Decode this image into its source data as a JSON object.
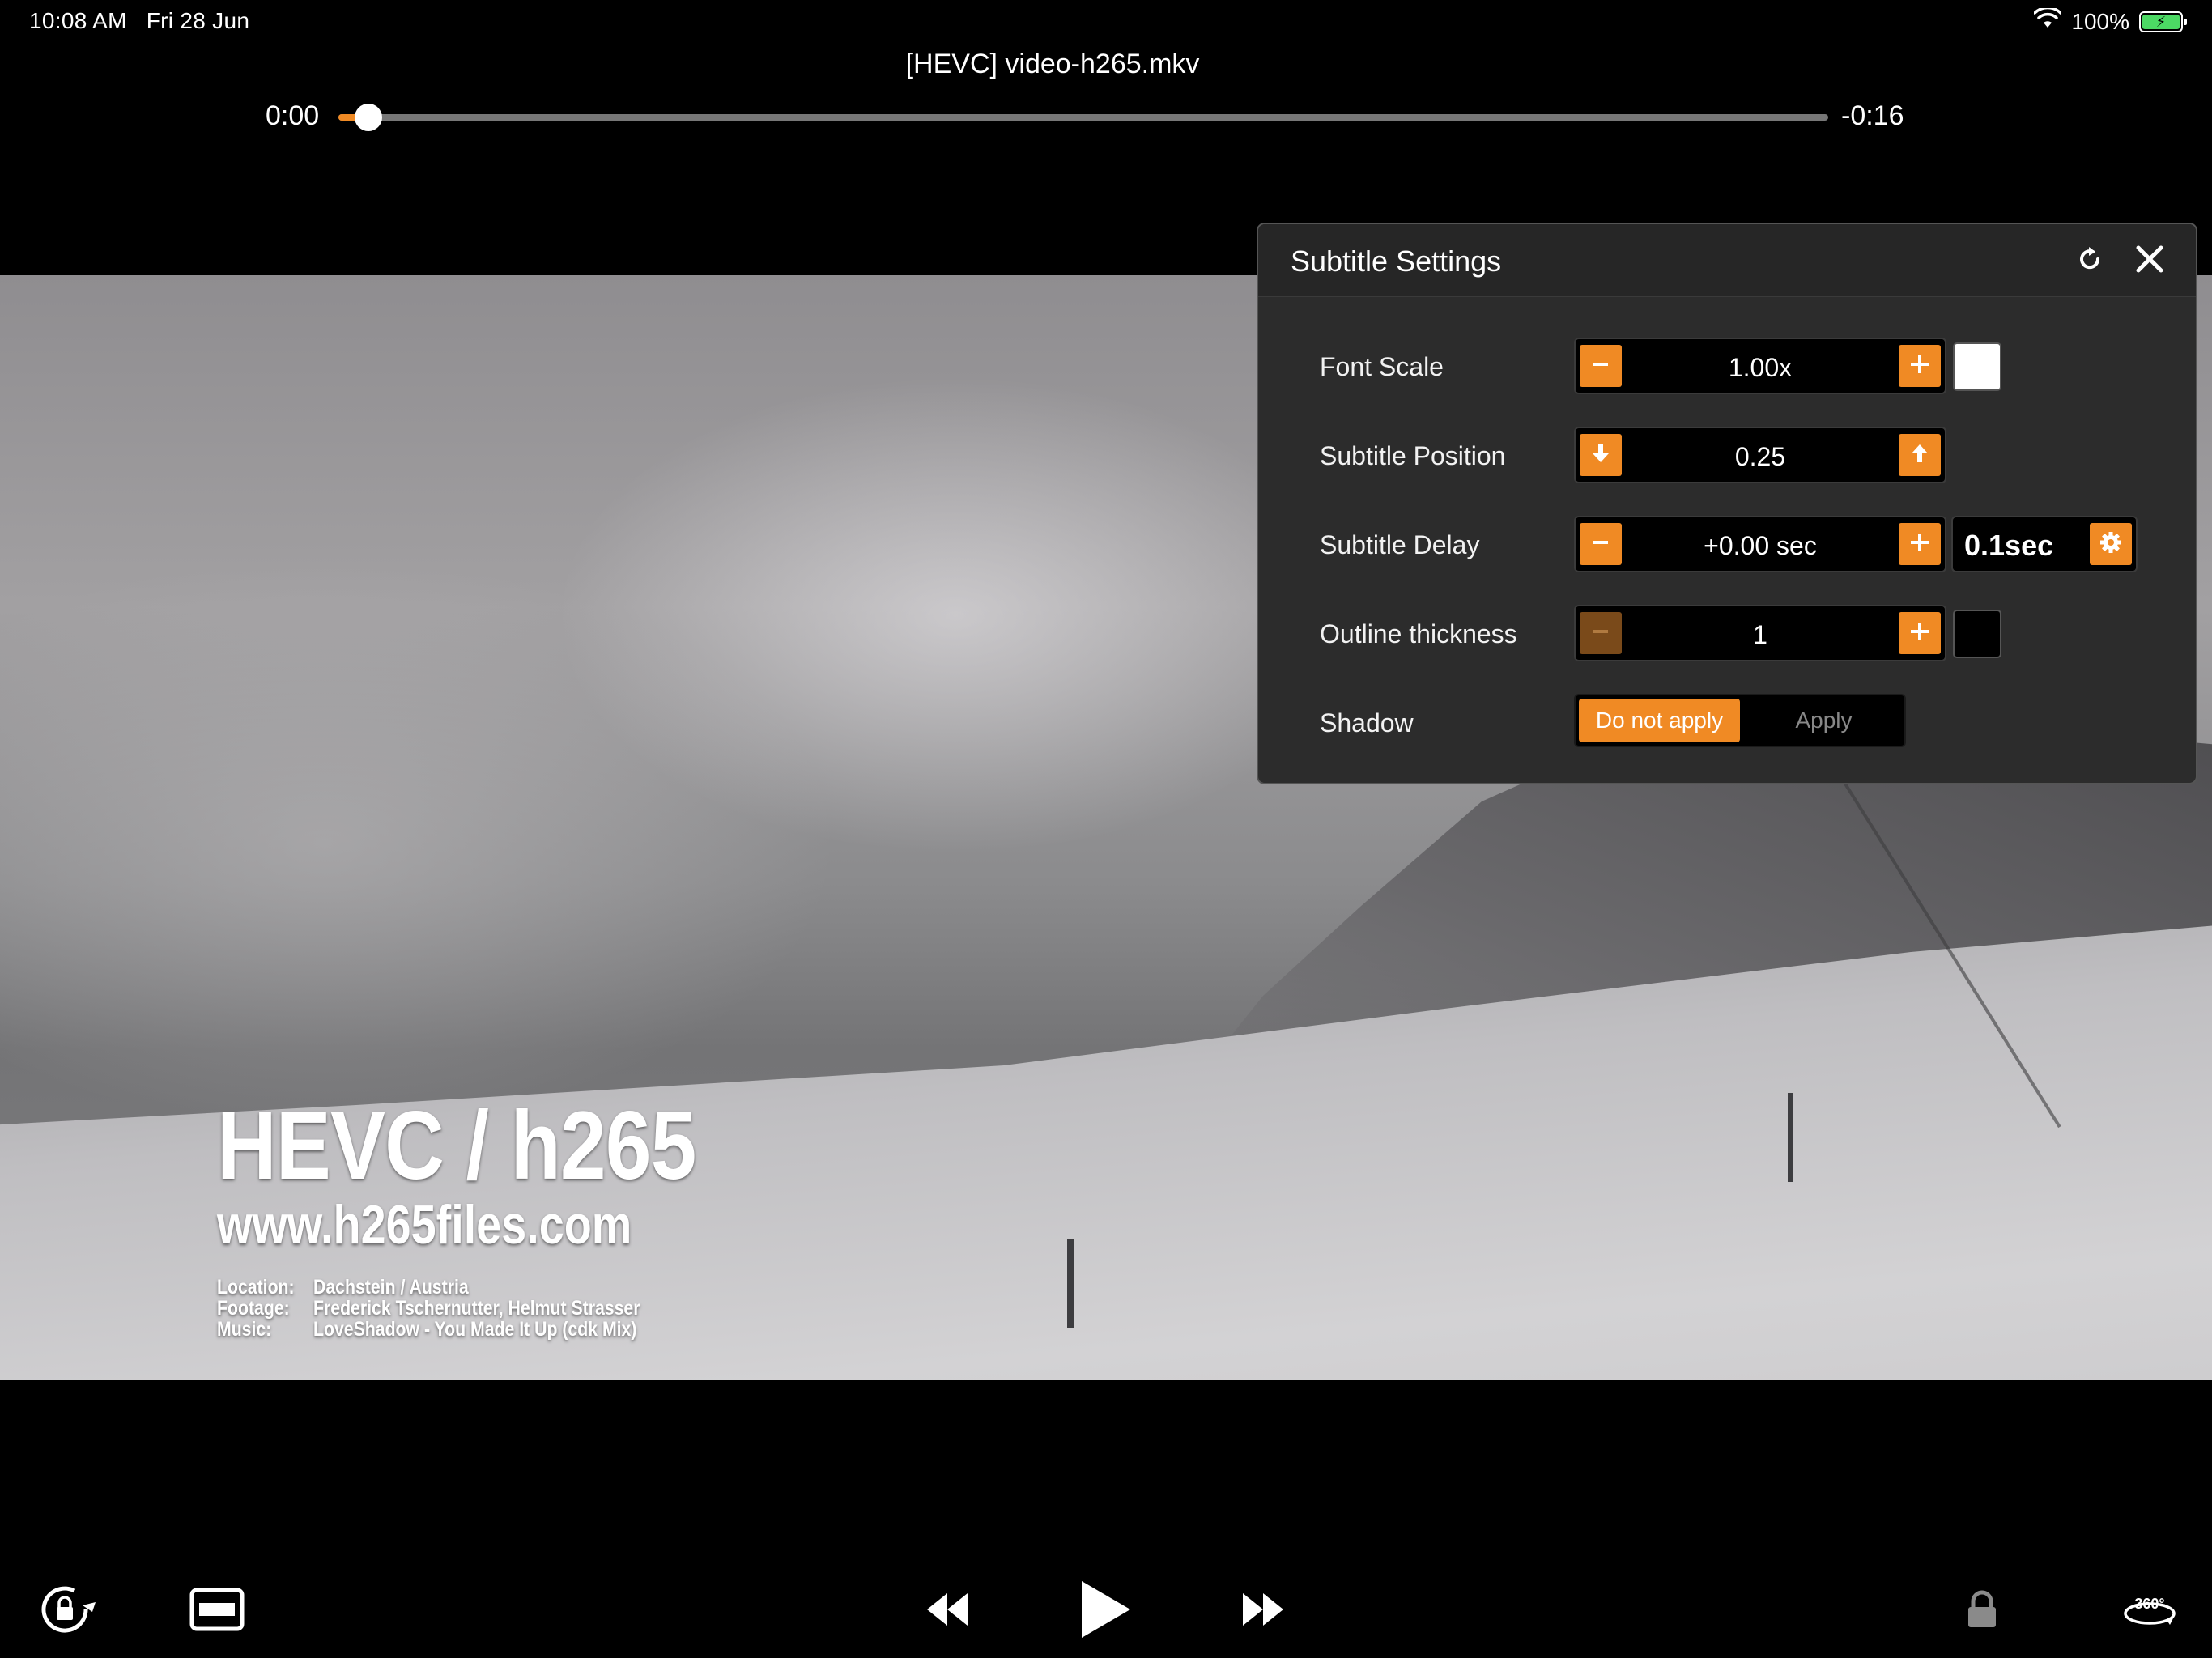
{
  "status_bar": {
    "time": "10:08 AM",
    "date": "Fri 28 Jun",
    "battery": "100%"
  },
  "player": {
    "title": "[HEVC] video-h265.mkv",
    "elapsed": "0:00",
    "remaining": "-0:16",
    "progress": 0.02
  },
  "video_overlay": {
    "headline": "HEVC / h265",
    "url": "www.h265files.com",
    "credits": [
      {
        "label": "Location:",
        "value": "Dachstein / Austria"
      },
      {
        "label": "Footage:",
        "value": "Frederick Tschernutter, Helmut Strasser"
      },
      {
        "label": "Music:",
        "value": "LoveShadow - You Made It Up (cdk Mix)"
      }
    ]
  },
  "subtitle_settings": {
    "title": "Subtitle Settings",
    "font_scale": {
      "label": "Font Scale",
      "value": "1.00x",
      "color": "#ffffff"
    },
    "position": {
      "label": "Subtitle Position",
      "value": "0.25"
    },
    "delay": {
      "label": "Subtitle Delay",
      "value": "+0.00 sec",
      "step": "0.1sec"
    },
    "outline": {
      "label": "Outline thickness",
      "value": "1",
      "color": "#000000"
    },
    "shadow": {
      "label": "Shadow",
      "options": [
        "Do not apply",
        "Apply"
      ],
      "selected": "Do not apply"
    }
  },
  "colors": {
    "accent": "#f08a24",
    "panel_bg": "#2c2c2c",
    "battery": "#4cd964"
  },
  "icons": {
    "refresh": "refresh-icon",
    "close": "close-icon",
    "rotation_lock": "rotation-lock-icon",
    "aspect": "aspect-ratio-icon",
    "rewind": "rewind-icon",
    "play": "play-icon",
    "forward": "fast-forward-icon",
    "lock": "lock-icon",
    "vr": "360-icon"
  }
}
